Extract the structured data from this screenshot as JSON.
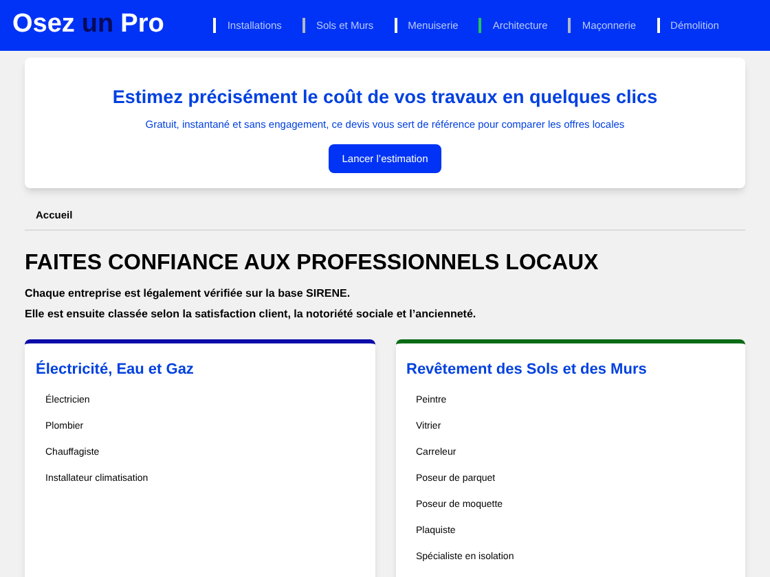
{
  "header": {
    "logo": [
      {
        "text": "Osez",
        "kind": "plain"
      },
      {
        "text": "un",
        "kind": "accent"
      },
      {
        "text": "Pro",
        "kind": "plain"
      }
    ],
    "nav": [
      {
        "label": "Installations",
        "color": "#ffffff"
      },
      {
        "label": "Sols et Murs",
        "color": "#b0b8c8"
      },
      {
        "label": "Menuiserie",
        "color": "#ffffff"
      },
      {
        "label": "Architecture",
        "color": "#22c55e"
      },
      {
        "label": "Maçonnerie",
        "color": "#b0b8c8"
      },
      {
        "label": "Démolition",
        "color": "#ffffff"
      }
    ]
  },
  "banner": {
    "title": "Estimez précisément le coût de vos travaux en quelques clics",
    "subtitle": "Gratuit, instantané et sans engagement, ce devis vous sert de référence pour comparer les offres locales",
    "button": "Lancer l’estimation"
  },
  "breadcrumb": [
    "Accueil"
  ],
  "intro": {
    "heading": "FAITES CONFIANCE AUX PROFESSIONNELS LOCAUX",
    "lines": [
      "Chaque entreprise est légalement vérifiée sur la base SIRENE.",
      "Elle est ensuite classée selon la satisfaction client, la notoriété sociale et l’ancienneté."
    ]
  },
  "categories": [
    {
      "title": "Électricité, Eau et Gaz",
      "color": "#0a0aa8",
      "items": [
        "Électricien",
        "Plombier",
        "Chauffagiste",
        "Installateur climatisation"
      ]
    },
    {
      "title": "Revêtement des Sols et des Murs",
      "color": "#0a6b16",
      "items": [
        "Peintre",
        "Vitrier",
        "Carreleur",
        "Poseur de parquet",
        "Poseur de moquette",
        "Plaquiste",
        "Spécialiste en isolation"
      ]
    }
  ]
}
